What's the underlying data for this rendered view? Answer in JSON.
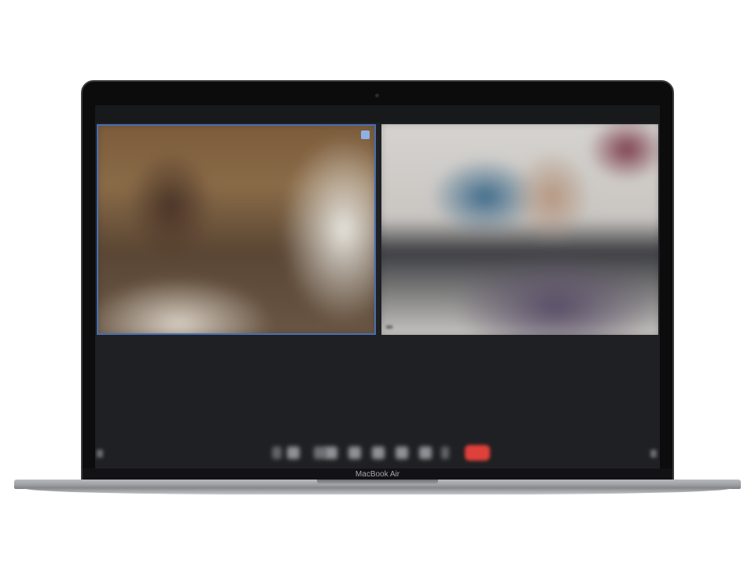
{
  "device": {
    "model_label": "MacBook Air"
  },
  "meeting": {
    "participants": [
      {
        "name_label": ""
      },
      {
        "name_label": ""
      }
    ],
    "toolbar": {
      "leave_button_color": "#e0403a",
      "button_icons": [
        "mic-icon",
        "video-icon",
        "security-icon",
        "participants-icon",
        "chat-icon",
        "share-screen-icon",
        "record-icon",
        "reactions-icon"
      ]
    },
    "active_speaker_border_color": "#4a6fb0"
  }
}
